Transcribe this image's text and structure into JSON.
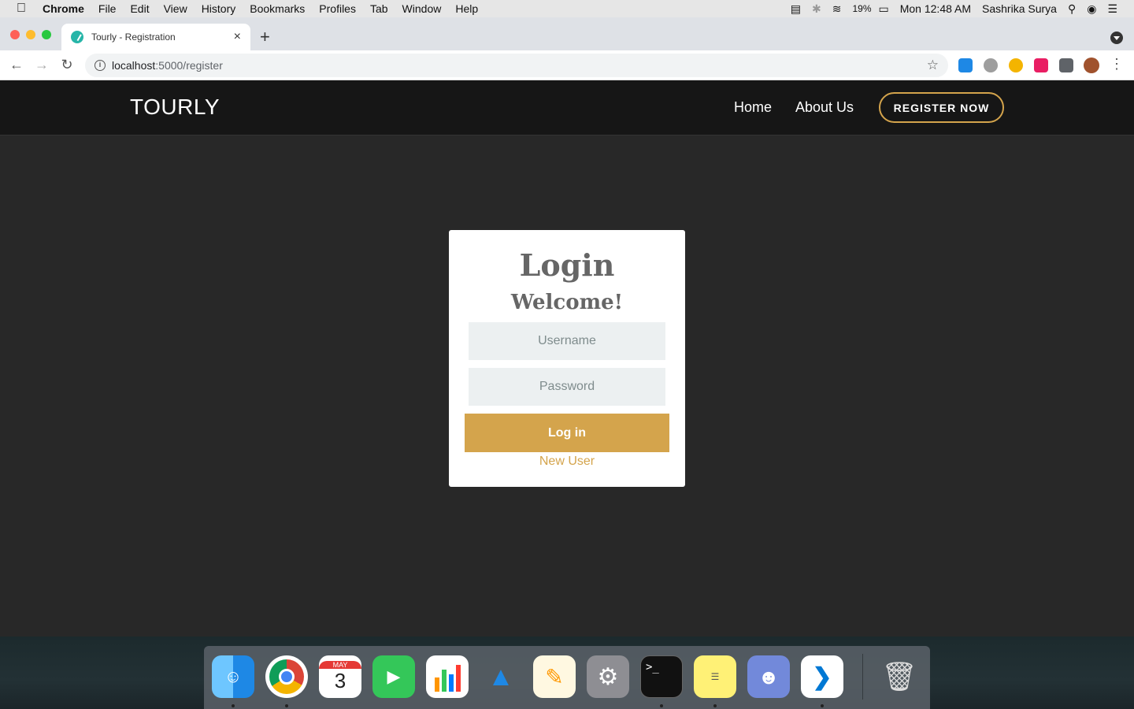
{
  "menubar": {
    "app_name": "Chrome",
    "menus": [
      "File",
      "Edit",
      "View",
      "History",
      "Bookmarks",
      "Profiles",
      "Tab",
      "Window",
      "Help"
    ],
    "battery": "19%",
    "clock": "Mon 12:48 AM",
    "user": "Sashrika Surya"
  },
  "browser": {
    "tab_title": "Tourly - Registration",
    "url_host": "localhost",
    "url_path": ":5000/register"
  },
  "site": {
    "brand": "TOURLY",
    "nav": {
      "home": "Home",
      "about": "About Us",
      "register": "REGISTER NOW"
    },
    "accent_color": "#d4a44c"
  },
  "login_card": {
    "title": "Login",
    "subtitle": "Welcome!",
    "username_placeholder": "Username",
    "password_placeholder": "Password",
    "submit_label": "Log in",
    "new_user_link": "New User"
  },
  "dock": {
    "apps": [
      "finder-icon",
      "chrome-icon",
      "calendar-icon",
      "facetime-icon",
      "numbers-icon",
      "keynote-icon",
      "pages-icon",
      "system-preferences-icon",
      "terminal-icon",
      "stickies-icon",
      "discord-icon",
      "vscode-icon",
      "trash-icon"
    ],
    "calendar_month": "MAY",
    "calendar_day": "3"
  }
}
